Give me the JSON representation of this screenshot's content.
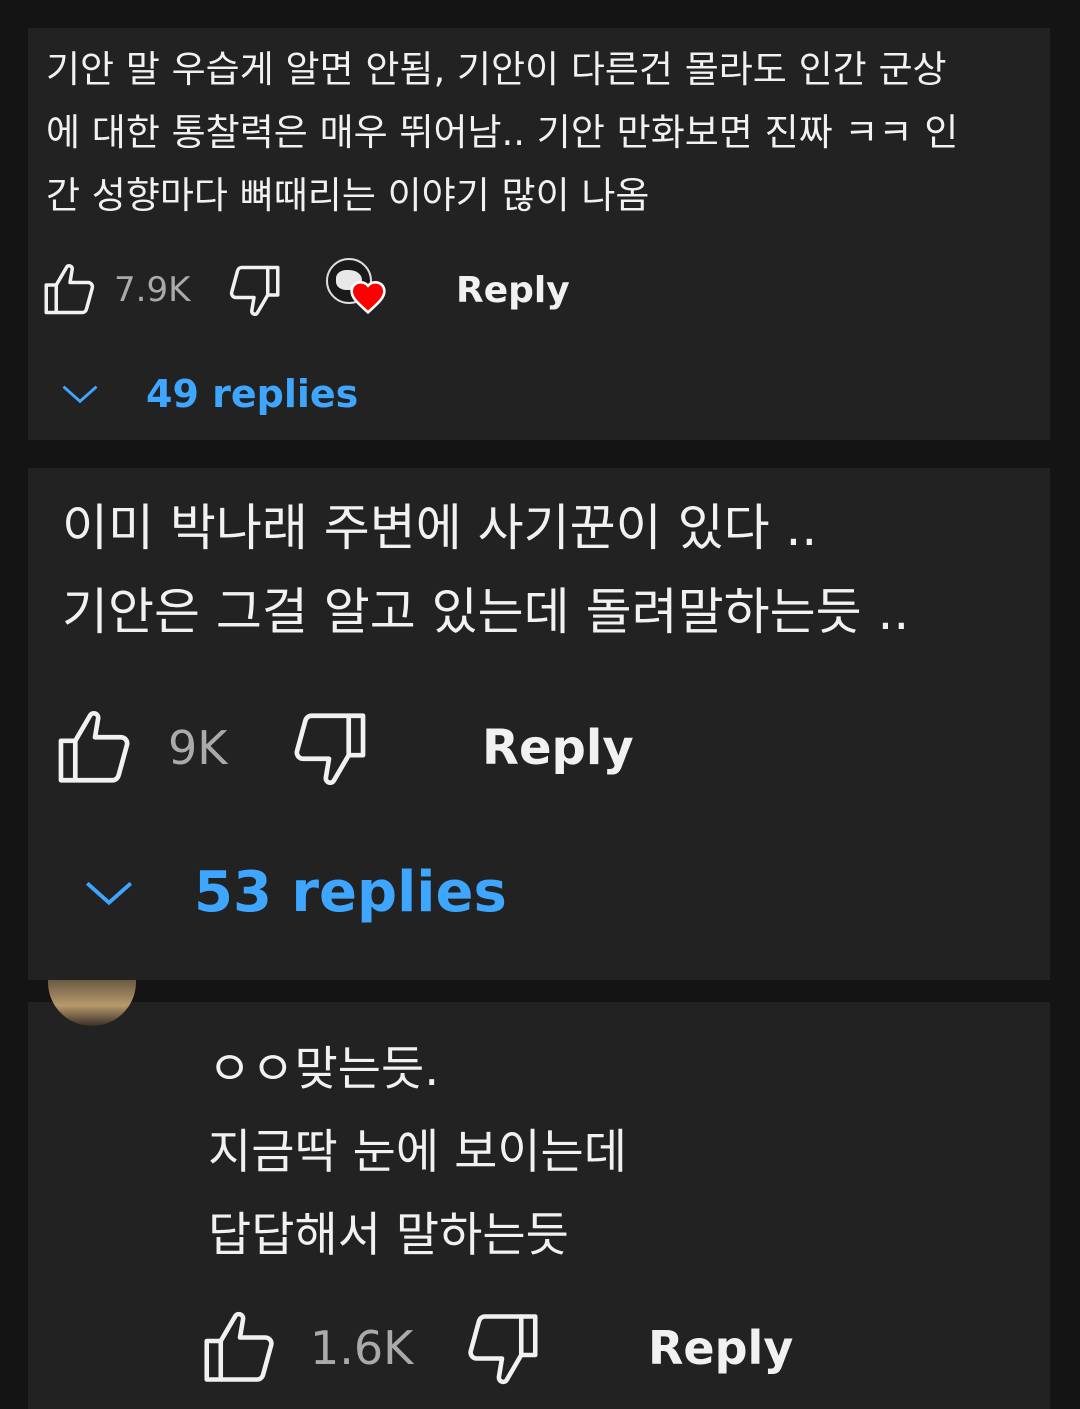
{
  "comments": [
    {
      "text": "기안 말 우습게 알면 안됨, 기안이 다른건 몰라도 인간 군상\n에 대한 통찰력은 매우 뛰어남..  기안 만화보면 진짜 ㅋㅋ 인\n간 성향마다 뼈때리는 이야기 많이 나옴",
      "likes": "7.9K",
      "reply_label": "Reply",
      "replies_label": "49 replies",
      "creator_heart": true
    },
    {
      "text": "이미 박나래 주변에 사기꾼이 있다 ..\n기안은 그걸 알고 있는데 돌려말하는듯 ..",
      "likes": "9K",
      "reply_label": "Reply",
      "replies_label": "53 replies"
    },
    {
      "text": "ㅇㅇ맞는듯.\n지금딱 눈에 보이는데\n답답해서 말하는듯",
      "likes": "1.6K",
      "reply_label": "Reply"
    }
  ],
  "icons": {
    "like": "thumb-up-icon",
    "dislike": "thumb-down-icon",
    "expand": "chevron-down-icon",
    "creator_heart": "heart-icon"
  },
  "colors": {
    "background": "#141414",
    "card": "#222222",
    "text": "#f1f1f1",
    "count": "#aaaaaa",
    "link": "#3ea6ff",
    "heart": "#ff0000"
  }
}
